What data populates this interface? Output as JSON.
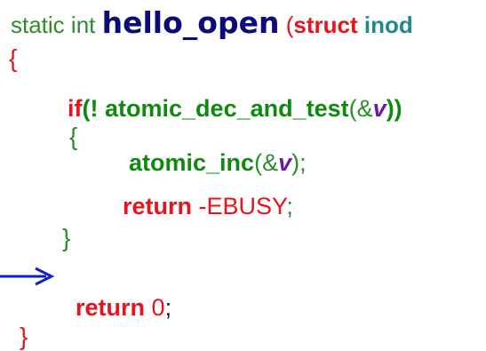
{
  "code": {
    "line1": {
      "kw_static": "static",
      "kw_int": "int",
      "func_name": "hello_open",
      "paren": "(",
      "kw_struct": "struct",
      "type_inode": "inod"
    },
    "line2": {
      "brace": "{"
    },
    "line3": {
      "kw_if": "if",
      "open_paren": "(",
      "not": "!",
      "call": "atomic_dec_and_test",
      "inner_open": "(",
      "amp": "&",
      "var": "v",
      "close": "))"
    },
    "line4": {
      "brace": "{"
    },
    "line5": {
      "call": "atomic_inc",
      "open": "(",
      "amp": "&",
      "var": "v",
      "close": ");"
    },
    "line6": {
      "kw_return": "return",
      "minus": "-",
      "value": "EBUSY",
      "semicolon": ";"
    },
    "line7": {
      "brace": "}"
    },
    "line9": {
      "kw_return": "return",
      "value": "0",
      "semicolon": ";"
    },
    "line10": {
      "brace": "}"
    }
  },
  "arrow": {
    "icon": "right-arrow-icon",
    "color": "#1020d0"
  }
}
